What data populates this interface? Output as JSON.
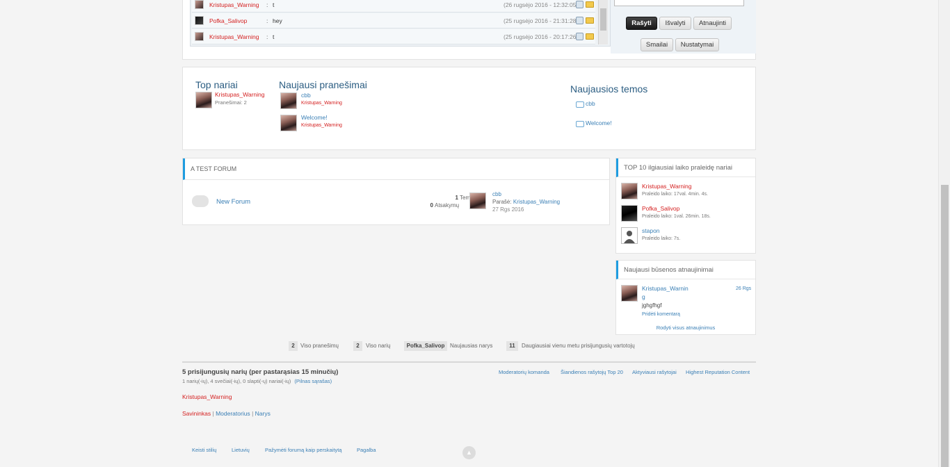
{
  "shoutbox": {
    "rows": [
      {
        "name": "Kristupas_Warning",
        "sep": ":",
        "message": "t",
        "time": "(26 rugsėjo 2016 - 12:32:05)",
        "name_color": "red",
        "avatar": "avatar-icon"
      },
      {
        "name": "Pofka_Salivop",
        "sep": ":",
        "message": "hey",
        "time": "(25 rugsėjo 2016 - 21:31:28)",
        "name_color": "red",
        "avatar": "avatar-icon"
      },
      {
        "name": "Kristupas_Warning",
        "sep": ":",
        "message": "t",
        "time": "(25 rugsėjo 2016 - 20:17:26)",
        "name_color": "red",
        "avatar": "avatar-icon"
      }
    ],
    "buttons": {
      "write": "Rašyti",
      "clear": "Išvalyti",
      "refresh": "Atnaujinti",
      "smilies": "Smailai",
      "settings": "Nustatymai"
    }
  },
  "stats_box": {
    "top_members": {
      "title": "Top nariai",
      "name": "Kristupas_Warning",
      "posts": "Pranešimai: 2"
    },
    "latest_posts": {
      "title": "Naujausi pranešimai",
      "items": [
        {
          "title": "cbb",
          "author": "Kristupas_Warning"
        },
        {
          "title": "Welcome!",
          "author": "Kristupas_Warning"
        }
      ]
    },
    "latest_topics": {
      "title": "Naujausios temos",
      "items": [
        "cbb",
        "Welcome!"
      ]
    }
  },
  "forum": {
    "category": "A TEST FORUM",
    "forum_name": "New Forum",
    "topics_count": "1",
    "topics_label": "Temų",
    "replies_count": "0",
    "replies_label": "Atsakymų",
    "last_post_title": "cbb",
    "last_post_by_label": "Parašė:",
    "last_post_author": "Kristupas_Warning",
    "last_post_date": "27 Rgs 2016"
  },
  "top10": {
    "title": "TOP 10 ilgiausiai laiko praleidę nariai",
    "items": [
      {
        "name": "Kristupas_Warning",
        "time": "Praleido laiko: 17val. 4min. 4s.",
        "color": "red"
      },
      {
        "name": "Pofka_Salivop",
        "time": "Praleido laiko: 1val. 26min. 18s.",
        "color": "red"
      },
      {
        "name": "stapon",
        "time": "Praleido laiko: 7s.",
        "color": "blue"
      }
    ]
  },
  "status_updates": {
    "title": "Naujausi būsenos atnaujinimai",
    "name_line1": "Kristupas_Warnin",
    "name_line2": "g",
    "date": "26 Rgs",
    "text": "jghgfhgf",
    "add_comment": "Pridėti komentarą",
    "show_all": "Rodyti visus atnaujinimus"
  },
  "board_stats": {
    "total_posts_num": "2",
    "total_posts_label": "Viso pranešimų",
    "total_members_num": "2",
    "total_members_label": "Viso narių",
    "newest_member": "Pofka_Salivop",
    "newest_label": "Naujausias narys",
    "most_online_num": "11",
    "most_online_label": "Daugiausiai vienu metu prisijungusių vartotojų"
  },
  "online": {
    "title": "5 prisijungusių narių (per pastarąsias 15 minučių)",
    "breakdown": "1 narių(-ių), 4 svečiai(-ių), 0 slapti(-ų) nariai(-ių)",
    "full_list": "(Pilnas sąrašas)",
    "links": [
      "Moderatorių komanda",
      "Šiandienos rašytojų Top 20",
      "Aktyviausi rašytojai",
      "Highest Reputation Content"
    ],
    "member": "Kristupas_Warning",
    "legend": {
      "owner": "Savininkas",
      "sep": "|",
      "moderator": "Moderatorius",
      "member": "Narys"
    }
  },
  "footer": {
    "links": [
      "Keisti stilių",
      "Lietuvių",
      "Pažymėti forumą kaip perskaitytą",
      "Pagalba"
    ]
  },
  "colors": {
    "accent": "#1e9ce0",
    "link": "#3a7fb5",
    "red_name": "#d42020"
  }
}
